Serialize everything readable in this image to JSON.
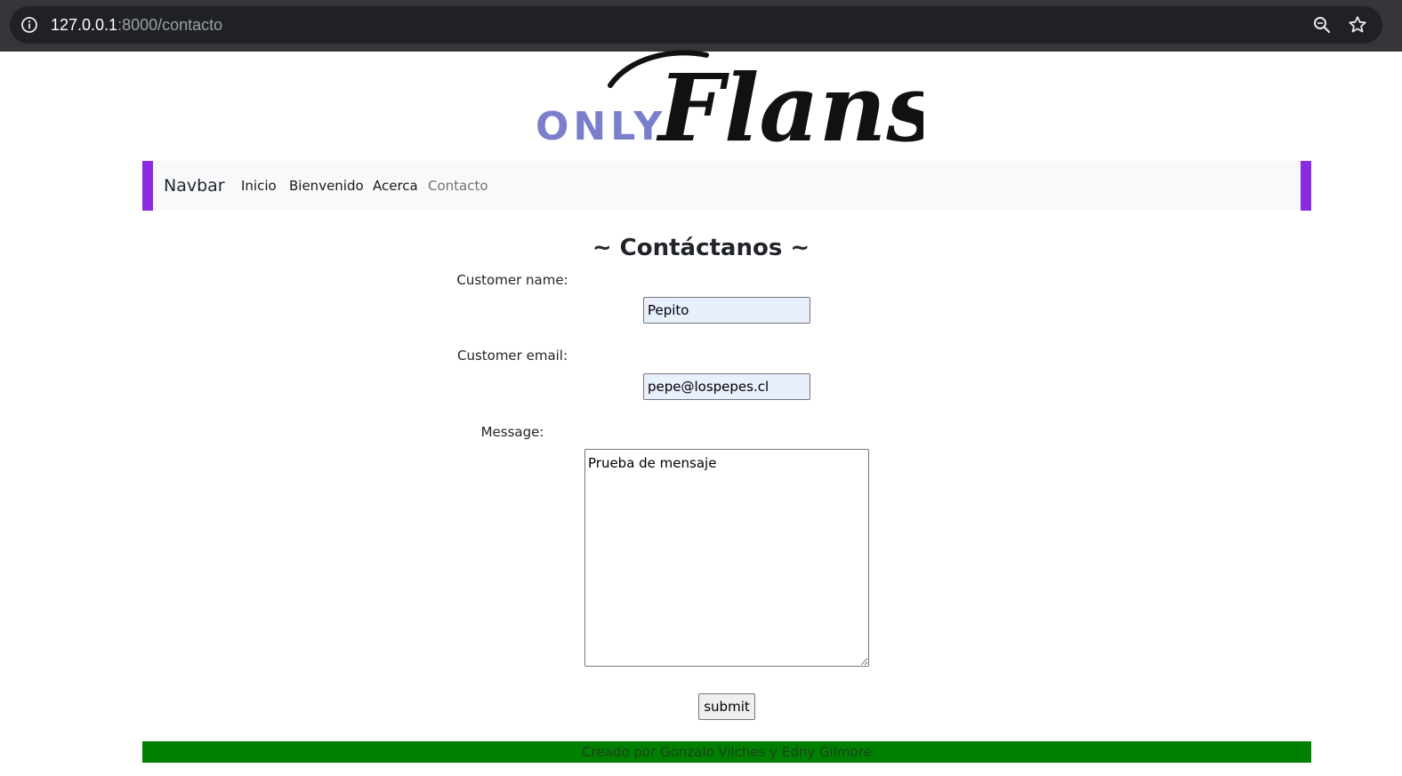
{
  "browser": {
    "url_host": "127.0.0.1",
    "url_rest": ":8000/contacto"
  },
  "logo": {
    "word_small": "ONLY",
    "word_script": "Flans"
  },
  "navbar": {
    "brand": "Navbar",
    "links": [
      {
        "label": "Inicio"
      },
      {
        "label": "Bienvenido"
      },
      {
        "label": "Acerca"
      },
      {
        "label": "Contacto"
      }
    ],
    "accent_color": "#8a2be2"
  },
  "form": {
    "title": "~ Contáctanos ~",
    "name_label": "Customer name:",
    "name_value": "Pepito",
    "email_label": "Customer email:",
    "email_value": "pepe@lospepes.cl",
    "message_label": "Message:",
    "message_value": "Prueba de mensaje",
    "submit_label": "submit"
  },
  "footer": {
    "text": "Creado por Gonzalo Vilches y Edny Gilmore",
    "color": "#008000"
  }
}
